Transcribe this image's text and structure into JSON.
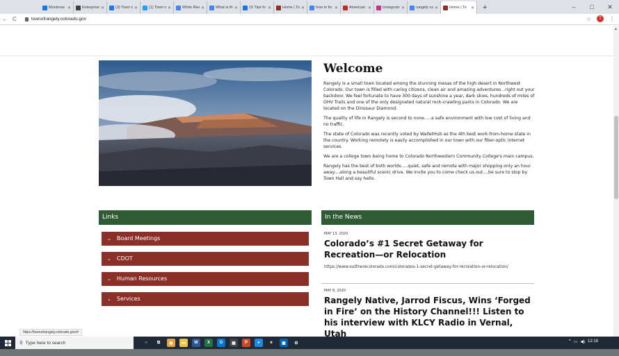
{
  "browser": {
    "tabs": [
      {
        "label": "Montrose",
        "color": "#1a73e8"
      },
      {
        "label": "Enterprise",
        "color": "#3c4043"
      },
      {
        "label": "(3) Town o",
        "color": "#1877f2"
      },
      {
        "label": "(1) Town o",
        "color": "#1da1f2"
      },
      {
        "label": "White Rive",
        "color": "#4285f4"
      },
      {
        "label": "What is thi",
        "color": "#4285f4"
      },
      {
        "label": "15 Tips fo",
        "color": "#1a73e8"
      },
      {
        "label": "Home | To",
        "color": "#8b3029"
      },
      {
        "label": "how to fix",
        "color": "#4285f4"
      },
      {
        "label": "American",
        "color": "#c62828"
      },
      {
        "label": "Instagram",
        "color": "#c13584"
      },
      {
        "label": "rangely co",
        "color": "#4285f4"
      },
      {
        "label": "Home | To",
        "color": "#8b3029",
        "active": true
      }
    ],
    "new_tab": "+",
    "window_controls": {
      "minimize": "–",
      "maximize": "□",
      "close": "✕"
    },
    "back": "←",
    "reload": "C",
    "url": "townofrangely.colorado.gov",
    "star": "☆",
    "profile_initial": "T",
    "menu": "⋮",
    "status_url": "https://townofrangely.colorado.gov/#"
  },
  "welcome": {
    "heading": "Welcome",
    "paragraphs": [
      "Rangely is a small town located among the stunning mesas of the high desert in Northwest Colorado.  Our town is filled with caring citizens, clean air and amazing adventures...right out your backdoor.  We feel fortunate to have 300 days of sunshine a year, dark skies, hundreds of miles of OHV Trails and one of the only designated natural rock-crawling parks in Colorado.  We are located on the Dinosaur Diamond.",
      "The quality of life in Rangely is second to none.....a safe environment with low cost of living and no traffic.",
      "The state of Colorado was recently voted by WalletHub as the 4th best work-from-home state in the country.  Working remotely is easily accomplished in our town with our fiber-optic internet services.",
      "We are a college town being home to Colorado Northwestern Community College's main campus.",
      "Rangely has the best of both worlds.....quiet, safe and remote with major shopping only an hour away....along a beautiful scenic drive.  We invite you to come check us out....be sure to stop by Town Hall and say hello."
    ]
  },
  "links": {
    "heading": "Links",
    "items": [
      "Board Meetings",
      "CDOT",
      "Human Resources",
      "Services"
    ]
  },
  "news": {
    "heading": "In the News",
    "items": [
      {
        "date": "MAY 13, 2020",
        "title": "Colorado’s #1 Secret Getaway for Recreation—or Relocation",
        "link": "https://www.outtherecolorado.com/colorados-1-secret-getaway-for-recreation-or-relocation/"
      },
      {
        "date": "MAY 8, 2020",
        "title": "Rangely Native, Jarrod Fiscus, Wins ‘Forged in Fire’ on the History Channel!!! Listen to his interview with KLCY Radio in Vernal, Utah"
      }
    ]
  },
  "taskbar": {
    "search_placeholder": "Type here to search",
    "apps": [
      {
        "icon": "cortana-icon",
        "color": "#1f2a36",
        "glyph": "○"
      },
      {
        "icon": "task-view-icon",
        "color": "#1f2a36",
        "glyph": "⧉"
      },
      {
        "icon": "chrome-icon",
        "color": "#e8a33d",
        "glyph": "◉"
      },
      {
        "icon": "file-explorer-icon",
        "color": "#f4c542",
        "glyph": "▬"
      },
      {
        "icon": "word-icon",
        "color": "#2b579a",
        "glyph": "W"
      },
      {
        "icon": "excel-icon",
        "color": "#217346",
        "glyph": "X"
      },
      {
        "icon": "outlook-icon",
        "color": "#0078d4",
        "glyph": "O"
      },
      {
        "icon": "calculator-icon",
        "color": "#444444",
        "glyph": "▦"
      },
      {
        "icon": "powerpoint-icon",
        "color": "#d24726",
        "glyph": "P"
      },
      {
        "icon": "teams-icon",
        "color": "#1e88e5",
        "glyph": "●"
      },
      {
        "icon": "edge-icon",
        "color": "#1f2a36",
        "glyph": "e"
      },
      {
        "icon": "photos-icon",
        "color": "#0063b1",
        "glyph": "▣"
      },
      {
        "icon": "settings-icon",
        "color": "#1f2a36",
        "glyph": "⚙"
      }
    ],
    "tray_time": "12:18"
  }
}
